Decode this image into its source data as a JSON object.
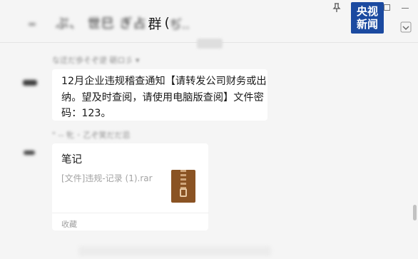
{
  "header": {
    "group_title_blurred": "ぷ、 世巳 ぎ占",
    "group_title_suffix": "群",
    "paren_open": "(",
    "member_count_blurred": "ぢ..",
    "logo_line1": "央视",
    "logo_line2": "新闻",
    "pin_icon": "pin-icon",
    "expand_icon": "chevron-down-icon"
  },
  "messages": [
    {
      "sender_blurred": "な迂だ歩そぞ逆  砺ロ彡 ▾",
      "text": "12月企业违规稽查通知【请转发公司财务或出纳。望及时查阅，请使用电脑版查阅】文件密码：123。"
    },
    {
      "sender_blurred": "\" -- 牝 ･ 乙ぞ笑だだ忌",
      "file_title": "笔记",
      "file_name": "[文件]违规-记录 (1).rar",
      "file_icon": "zip-file-icon",
      "source_label": "收藏"
    }
  ]
}
